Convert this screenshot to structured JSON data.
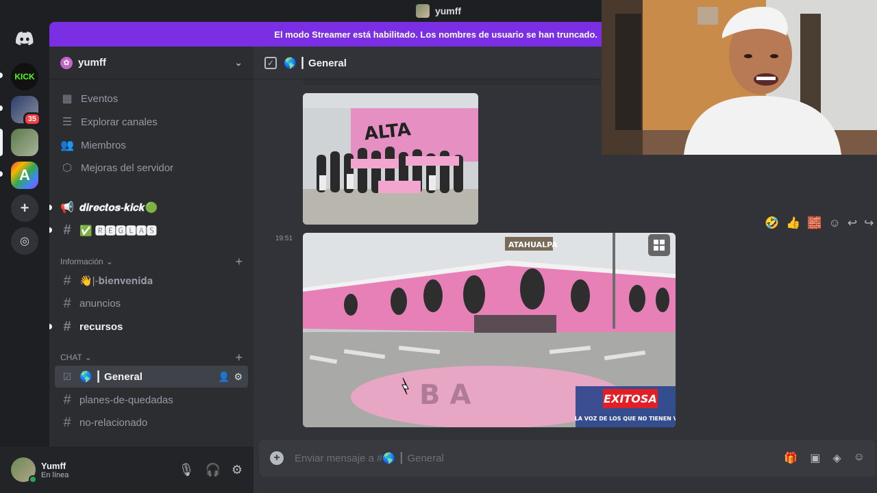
{
  "window": {
    "title": "yumff"
  },
  "banner": {
    "text": "El modo Streamer está habilitado. Los nombres de usuario se han truncado."
  },
  "rail": {
    "kick_label": "KICK",
    "badge_count": "35",
    "a_label": "A"
  },
  "server": {
    "name": "yumff"
  },
  "nav": [
    {
      "label": "Eventos",
      "icon": "calendar-icon"
    },
    {
      "label": "Explorar canales",
      "icon": "browse-icon"
    },
    {
      "label": "Miembros",
      "icon": "members-icon"
    },
    {
      "label": "Mejoras del servidor",
      "icon": "boost-icon"
    }
  ],
  "channels_top": [
    {
      "label": "𝒅𝒊𝒓𝒆𝒄𝒕𝒐𝒔-𝒌𝒊𝒄𝒌🟢",
      "icon": "📢"
    },
    {
      "label": "✅ 🆁🅴🅶🅻🅰🆂",
      "icon": "#"
    }
  ],
  "categories": {
    "info": "Información",
    "chat": "CHAT"
  },
  "channels_info": [
    {
      "label": "👋|-𝐛𝐢𝐞𝐧𝐯𝐞𝐧𝐢𝐝𝐚"
    },
    {
      "label": "anuncios"
    },
    {
      "label": "recursos"
    }
  ],
  "channels_chat": [
    {
      "label": "🌎 ┃ General"
    },
    {
      "label": "planes-de-quedadas"
    },
    {
      "label": "no-relacionado"
    }
  ],
  "chat": {
    "header": "🌎 ┃ General",
    "timestamp": "19:51",
    "composer_placeholder": "Enviar mensaje a #🌎 ┃ General",
    "img2_badge": "EXITOSA",
    "img2_tagline": "LA VOZ DE LOS QUE NO TIENEN VOZ"
  },
  "user": {
    "name": "Yumff",
    "status": "En línea"
  },
  "colors": {
    "accent": "#7b2fe4",
    "online": "#23a55a",
    "badge": "#f23f43"
  }
}
